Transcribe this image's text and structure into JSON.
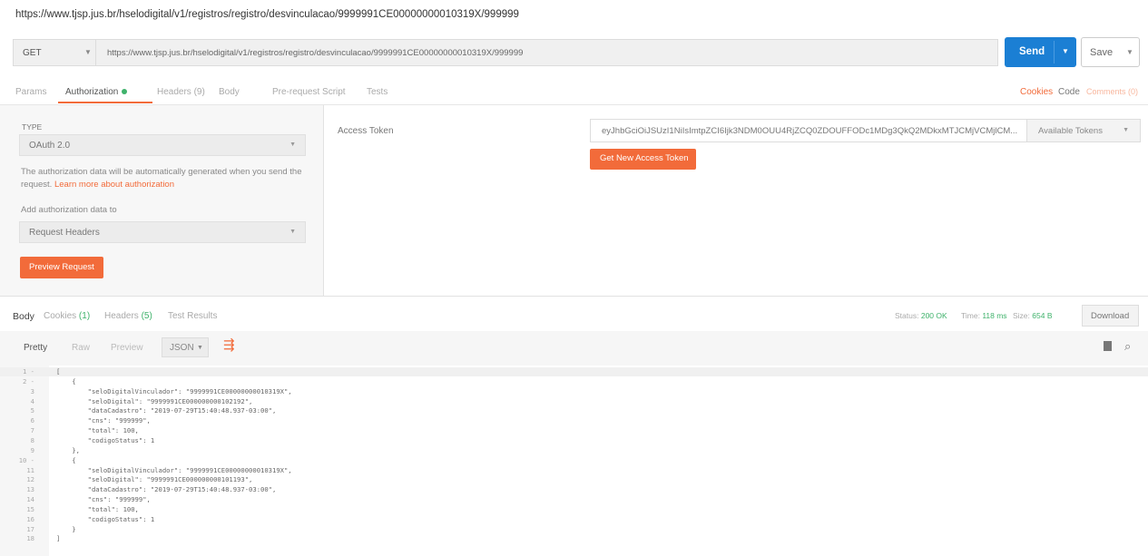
{
  "request": {
    "title": "https://www.tjsp.jus.br/hselodigital/v1/registros/registro/desvinculacao/9999991CE00000000010319X/999999",
    "method": "GET",
    "url": "https://www.tjsp.jus.br/hselodigital/v1/registros/registro/desvinculacao/9999991CE00000000010319X/999999",
    "send_label": "Send",
    "save_label": "Save"
  },
  "request_tabs": [
    {
      "label": "Params"
    },
    {
      "label": "Authorization"
    },
    {
      "label": "Headers (9)"
    },
    {
      "label": "Body"
    },
    {
      "label": "Pre-request Script"
    },
    {
      "label": "Tests"
    }
  ],
  "right_links": {
    "cookies": "Cookies",
    "code": "Code",
    "comments": "Comments (0)"
  },
  "auth": {
    "type_label": "TYPE",
    "type_value": "OAuth 2.0",
    "description": "The authorization data will be automatically generated when you send the request.",
    "learn_more": "Learn more about authorization",
    "add_to_label": "Add authorization data to",
    "add_to_value": "Request Headers",
    "preview_label": "Preview Request",
    "token_label": "Access Token",
    "token_value": "eyJhbGciOiJSUzI1NiIsImtpZCI6Ijk3NDM0OUU4RjZCQ0ZDOUFFODc1MDg3QkQ2MDkxMTJCMjVCMjlCM...",
    "available_tokens": "Available Tokens",
    "get_token_label": "Get New Access Token"
  },
  "response_tabs": [
    {
      "label": "Body"
    },
    {
      "label": "Cookies",
      "count": "(1)"
    },
    {
      "label": "Headers",
      "count": "(5)"
    },
    {
      "label": "Test Results"
    }
  ],
  "response_status": {
    "status_label": "Status:",
    "status_value": "200 OK",
    "time_label": "Time:",
    "time_value": "118 ms",
    "size_label": "Size:",
    "size_value": "654 B",
    "download_label": "Download"
  },
  "format_bar": {
    "pretty": "Pretty",
    "raw": "Raw",
    "preview": "Preview",
    "format": "JSON"
  },
  "code_lines": [
    "[",
    "    {",
    "        \"seloDigitalVinculador\": \"9999991CE00000000010319X\",",
    "        \"seloDigital\": \"9999991CE000000000102192\",",
    "        \"dataCadastro\": \"2019-07-29T15:40:48.937-03:00\",",
    "        \"cns\": \"999999\",",
    "        \"total\": 100,",
    "        \"codigoStatus\": 1",
    "    },",
    "    {",
    "        \"seloDigitalVinculador\": \"9999991CE00000000010319X\",",
    "        \"seloDigital\": \"9999991CE000000000101193\",",
    "        \"dataCadastro\": \"2019-07-29T15:40:48.937-03:00\",",
    "        \"cns\": \"999999\",",
    "        \"total\": 100,",
    "        \"codigoStatus\": 1",
    "    }",
    "]"
  ],
  "line_numbers": [
    "1 -",
    "2 -",
    "3",
    "4",
    "5",
    "6",
    "7",
    "8",
    "9",
    "10 -",
    "11",
    "12",
    "13",
    "14",
    "15",
    "16",
    "17",
    "18"
  ],
  "colors": {
    "accent": "#f26b3a",
    "send": "#1b7fd4",
    "ok": "#3fb26b"
  }
}
